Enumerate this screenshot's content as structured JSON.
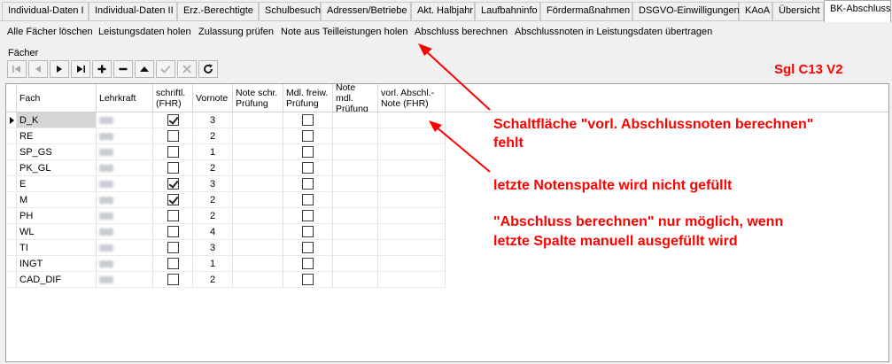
{
  "tabs": [
    {
      "label": "Individual-Daten I",
      "active": false
    },
    {
      "label": "Individual-Daten II",
      "active": false
    },
    {
      "label": "Erz.-Berechtigte",
      "active": false
    },
    {
      "label": "Schulbesuch",
      "active": false
    },
    {
      "label": "Adressen/Betriebe",
      "active": false
    },
    {
      "label": "Akt. Halbjahr",
      "active": false
    },
    {
      "label": "Laufbahninfo",
      "active": false
    },
    {
      "label": "Fördermaßnahmen",
      "active": false
    },
    {
      "label": "DSGVO-Einwilligungen",
      "active": false
    },
    {
      "label": "KAoA",
      "active": false
    },
    {
      "label": "Übersicht",
      "active": false
    },
    {
      "label": "BK-Abschluss",
      "active": true
    }
  ],
  "actions": [
    "Alle Fächer löschen",
    "Leistungsdaten holen",
    "Zulassung prüfen",
    "Note aus Teilleistungen holen",
    "Abschluss berechnen",
    "Abschlussnoten in Leistungsdaten übertragen"
  ],
  "group_label": "Fächer",
  "navigator_icons": [
    "first-record-icon",
    "prior-record-icon",
    "next-record-icon",
    "last-record-icon",
    "insert-icon",
    "delete-icon",
    "edit-icon",
    "post-icon",
    "cancel-icon",
    "refresh-icon"
  ],
  "grid": {
    "columns": [
      "Fach",
      "Lehrkraft",
      "schriftl.\n(FHR)",
      "Vornote",
      "Note schr.\nPrüfung",
      "Mdl. freiw.\nPrüfung",
      "Note mdl.\nPrüfung",
      "vorl. Abschl.-\nNote (FHR)"
    ],
    "rows": [
      {
        "fach": "D_K",
        "schriftl": true,
        "vornote": "3",
        "mdl_freiw": false
      },
      {
        "fach": "RE",
        "schriftl": false,
        "vornote": "2",
        "mdl_freiw": false
      },
      {
        "fach": "SP_GS",
        "schriftl": false,
        "vornote": "1",
        "mdl_freiw": false
      },
      {
        "fach": "PK_GL",
        "schriftl": false,
        "vornote": "2",
        "mdl_freiw": false
      },
      {
        "fach": "E",
        "schriftl": true,
        "vornote": "3",
        "mdl_freiw": false
      },
      {
        "fach": "M",
        "schriftl": true,
        "vornote": "2",
        "mdl_freiw": false
      },
      {
        "fach": "PH",
        "schriftl": false,
        "vornote": "2",
        "mdl_freiw": false
      },
      {
        "fach": "WL",
        "schriftl": false,
        "vornote": "4",
        "mdl_freiw": false
      },
      {
        "fach": "TI",
        "schriftl": false,
        "vornote": "3",
        "mdl_freiw": false
      },
      {
        "fach": "INGT",
        "schriftl": false,
        "vornote": "1",
        "mdl_freiw": false
      },
      {
        "fach": "CAD_DIF",
        "schriftl": false,
        "vornote": "2",
        "mdl_freiw": false
      }
    ]
  },
  "annotations": {
    "title": "Sgl C13 V2",
    "note1_line1": "Schaltfläche \"vorl. Abschlussnoten berechnen\"",
    "note1_line2": "fehlt",
    "note2": "letzte Notenspalte wird nicht gefüllt",
    "note3_line1": "\"Abschluss berechnen\" nur möglich, wenn",
    "note3_line2": "letzte Spalte manuell ausgefüllt wird",
    "color": "#ff0000"
  }
}
